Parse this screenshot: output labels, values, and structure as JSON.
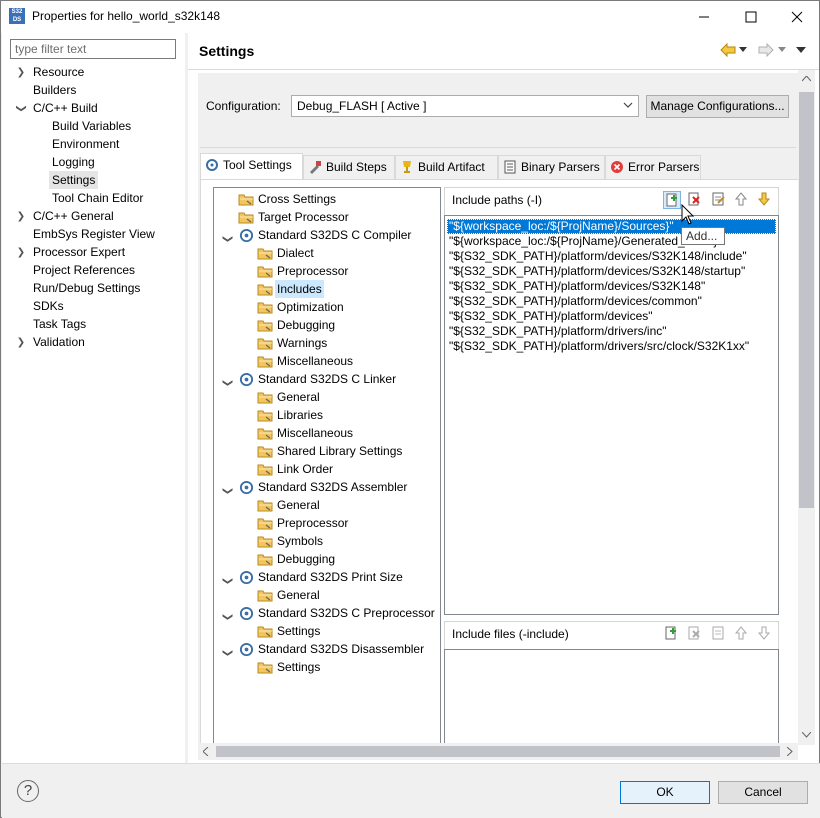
{
  "window": {
    "title": "Properties for hello_world_s32k148",
    "icon_text": "S32 DS"
  },
  "left_nav": {
    "filter_placeholder": "type filter text",
    "items": [
      {
        "label": "Resource",
        "expandable": true
      },
      {
        "label": "Builders",
        "expandable": false
      },
      {
        "label": "C/C++ Build",
        "expandable": true,
        "expanded": true
      },
      {
        "label": "Build Variables",
        "child": true
      },
      {
        "label": "Environment",
        "child": true
      },
      {
        "label": "Logging",
        "child": true
      },
      {
        "label": "Settings",
        "child": true,
        "selected": true
      },
      {
        "label": "Tool Chain Editor",
        "child": true
      },
      {
        "label": "C/C++ General",
        "expandable": true
      },
      {
        "label": "EmbSys Register View",
        "expandable": false
      },
      {
        "label": "Processor Expert",
        "expandable": true
      },
      {
        "label": "Project References",
        "expandable": false
      },
      {
        "label": "Run/Debug Settings",
        "expandable": false
      },
      {
        "label": "SDKs",
        "expandable": false
      },
      {
        "label": "Task Tags",
        "expandable": false
      },
      {
        "label": "Validation",
        "expandable": true
      }
    ]
  },
  "header": {
    "title": "Settings"
  },
  "config": {
    "label": "Configuration:",
    "value": "Debug_FLASH  [ Active ]",
    "manage_button": "Manage Configurations..."
  },
  "tabs": [
    {
      "label": "Tool Settings",
      "active": true,
      "icon": "tool-settings-icon"
    },
    {
      "label": "Build Steps",
      "icon": "build-steps-icon"
    },
    {
      "label": "Build Artifact",
      "icon": "trophy-icon"
    },
    {
      "label": "Binary Parsers",
      "icon": "binary-parsers-icon"
    },
    {
      "label": "Error Parsers",
      "icon": "error-icon"
    }
  ],
  "tool_tree": [
    {
      "label": "Cross Settings",
      "level": 1,
      "type": "folder"
    },
    {
      "label": "Target Processor",
      "level": 1,
      "type": "folder"
    },
    {
      "label": "Standard S32DS C Compiler",
      "level": 0,
      "type": "tool"
    },
    {
      "label": "Dialect",
      "level": 1,
      "type": "folder"
    },
    {
      "label": "Preprocessor",
      "level": 1,
      "type": "folder"
    },
    {
      "label": "Includes",
      "level": 1,
      "type": "folder",
      "selected": true
    },
    {
      "label": "Optimization",
      "level": 1,
      "type": "folder"
    },
    {
      "label": "Debugging",
      "level": 1,
      "type": "folder"
    },
    {
      "label": "Warnings",
      "level": 1,
      "type": "folder"
    },
    {
      "label": "Miscellaneous",
      "level": 1,
      "type": "folder"
    },
    {
      "label": "Standard S32DS C Linker",
      "level": 0,
      "type": "tool"
    },
    {
      "label": "General",
      "level": 1,
      "type": "folder"
    },
    {
      "label": "Libraries",
      "level": 1,
      "type": "folder"
    },
    {
      "label": "Miscellaneous",
      "level": 1,
      "type": "folder"
    },
    {
      "label": "Shared Library Settings",
      "level": 1,
      "type": "folder"
    },
    {
      "label": "Link Order",
      "level": 1,
      "type": "folder"
    },
    {
      "label": "Standard S32DS Assembler",
      "level": 0,
      "type": "tool"
    },
    {
      "label": "General",
      "level": 1,
      "type": "folder"
    },
    {
      "label": "Preprocessor",
      "level": 1,
      "type": "folder"
    },
    {
      "label": "Symbols",
      "level": 1,
      "type": "folder"
    },
    {
      "label": "Debugging",
      "level": 1,
      "type": "folder"
    },
    {
      "label": "Standard S32DS Print Size",
      "level": 0,
      "type": "tool"
    },
    {
      "label": "General",
      "level": 1,
      "type": "folder"
    },
    {
      "label": "Standard S32DS C Preprocessor",
      "level": 0,
      "type": "tool"
    },
    {
      "label": "Settings",
      "level": 1,
      "type": "folder"
    },
    {
      "label": "Standard S32DS Disassembler",
      "level": 0,
      "type": "tool"
    },
    {
      "label": "Settings",
      "level": 1,
      "type": "folder"
    }
  ],
  "include_paths": {
    "title": "Include paths (-I)",
    "items": [
      "\"${workspace_loc:/${ProjName}/Sources}\"",
      "\"${workspace_loc:/${ProjName}/Generated_Code}\"",
      "\"${S32_SDK_PATH}/platform/devices/S32K148/include\"",
      "\"${S32_SDK_PATH}/platform/devices/S32K148/startup\"",
      "\"${S32_SDK_PATH}/platform/devices/S32K148\"",
      "\"${S32_SDK_PATH}/platform/devices/common\"",
      "\"${S32_SDK_PATH}/platform/devices\"",
      "\"${S32_SDK_PATH}/platform/drivers/inc\"",
      "\"${S32_SDK_PATH}/platform/drivers/src/clock/S32K1xx\""
    ],
    "tooltip": "Add..."
  },
  "include_files": {
    "title": "Include files (-include)"
  },
  "footer": {
    "ok": "OK",
    "cancel": "Cancel"
  }
}
